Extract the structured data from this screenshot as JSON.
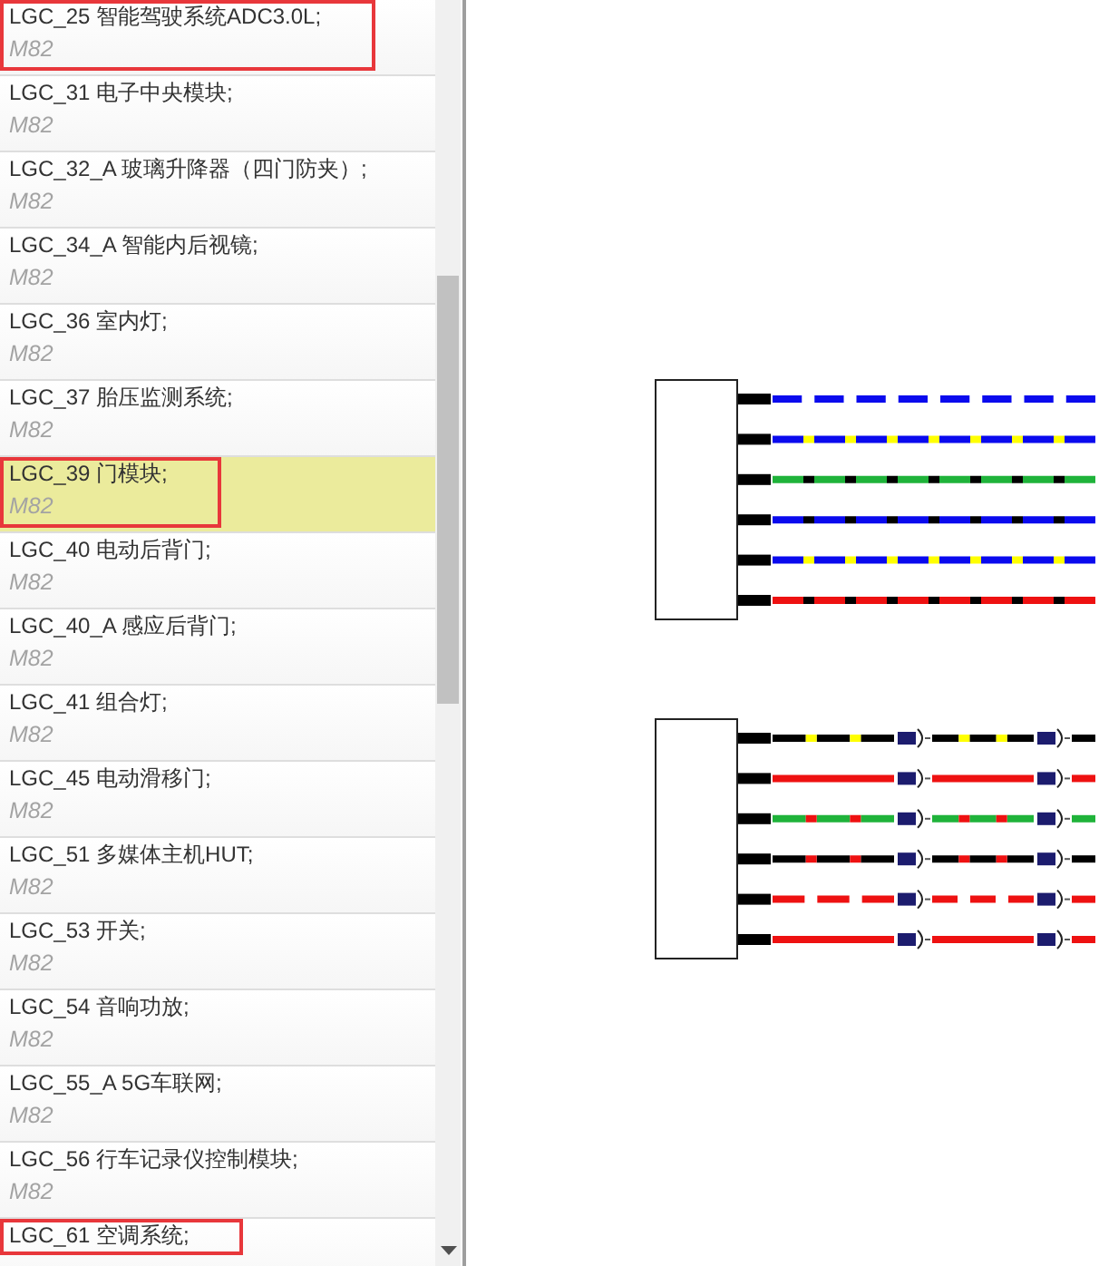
{
  "list": {
    "items": [
      {
        "title": "LGC_25 智能驾驶系统ADC3.0L;",
        "subtitle": "M82",
        "selected": false,
        "annotated": true
      },
      {
        "title": "LGC_31 电子中央模块;",
        "subtitle": "M82",
        "selected": false,
        "annotated": false
      },
      {
        "title": "LGC_32_A 玻璃升降器（四门防夹）;",
        "subtitle": "M82",
        "selected": false,
        "annotated": false
      },
      {
        "title": "LGC_34_A 智能内后视镜;",
        "subtitle": "M82",
        "selected": false,
        "annotated": false
      },
      {
        "title": "LGC_36 室内灯;",
        "subtitle": "M82",
        "selected": false,
        "annotated": false
      },
      {
        "title": "LGC_37 胎压监测系统;",
        "subtitle": "M82",
        "selected": false,
        "annotated": false
      },
      {
        "title": "LGC_39 门模块;",
        "subtitle": "M82",
        "selected": true,
        "annotated": true
      },
      {
        "title": "LGC_40 电动后背门;",
        "subtitle": "M82",
        "selected": false,
        "annotated": false
      },
      {
        "title": "LGC_40_A 感应后背门;",
        "subtitle": "M82",
        "selected": false,
        "annotated": false
      },
      {
        "title": "LGC_41 组合灯;",
        "subtitle": "M82",
        "selected": false,
        "annotated": false
      },
      {
        "title": "LGC_45 电动滑移门;",
        "subtitle": "M82",
        "selected": false,
        "annotated": false
      },
      {
        "title": "LGC_51 多媒体主机HUT;",
        "subtitle": "M82",
        "selected": false,
        "annotated": false
      },
      {
        "title": "LGC_53 开关;",
        "subtitle": "M82",
        "selected": false,
        "annotated": false
      },
      {
        "title": "LGC_54 音响功放;",
        "subtitle": "M82",
        "selected": false,
        "annotated": false
      },
      {
        "title": "LGC_55_A 5G车联网;",
        "subtitle": "M82",
        "selected": false,
        "annotated": false
      },
      {
        "title": "LGC_56 行车记录仪控制模块;",
        "subtitle": "M82",
        "selected": false,
        "annotated": false
      },
      {
        "title": "LGC_61 空调系统;",
        "selected": false,
        "annotated": true
      }
    ]
  },
  "diagrams": [
    {
      "inline_connectors": false,
      "wires": [
        {
          "kind": "dashed",
          "bands": [
            {
              "color": "#0a0aee"
            }
          ]
        },
        {
          "kind": "striped",
          "bands": [
            {
              "color": "#0a0aee"
            },
            {
              "color": "#ffff00"
            }
          ]
        },
        {
          "kind": "striped",
          "bands": [
            {
              "color": "#1fb33a"
            },
            {
              "color": "#000000"
            }
          ]
        },
        {
          "kind": "striped",
          "bands": [
            {
              "color": "#0a0aee"
            },
            {
              "color": "#000000"
            }
          ]
        },
        {
          "kind": "striped",
          "bands": [
            {
              "color": "#0a0aee"
            },
            {
              "color": "#ffff00"
            }
          ]
        },
        {
          "kind": "striped",
          "bands": [
            {
              "color": "#ee1111"
            },
            {
              "color": "#000000"
            }
          ]
        }
      ]
    },
    {
      "inline_connectors": true,
      "wires": [
        {
          "kind": "striped",
          "bands": [
            {
              "color": "#000000"
            },
            {
              "color": "#ffff00"
            }
          ]
        },
        {
          "kind": "solid",
          "bands": [
            {
              "color": "#ee1111"
            }
          ]
        },
        {
          "kind": "striped",
          "bands": [
            {
              "color": "#1fb33a"
            },
            {
              "color": "#ee1111"
            }
          ]
        },
        {
          "kind": "striped",
          "bands": [
            {
              "color": "#000000"
            },
            {
              "color": "#ee1111"
            }
          ]
        },
        {
          "kind": "dashed",
          "bands": [
            {
              "color": "#ee1111"
            }
          ]
        },
        {
          "kind": "solid",
          "bands": [
            {
              "color": "#ee1111"
            }
          ]
        }
      ]
    }
  ]
}
